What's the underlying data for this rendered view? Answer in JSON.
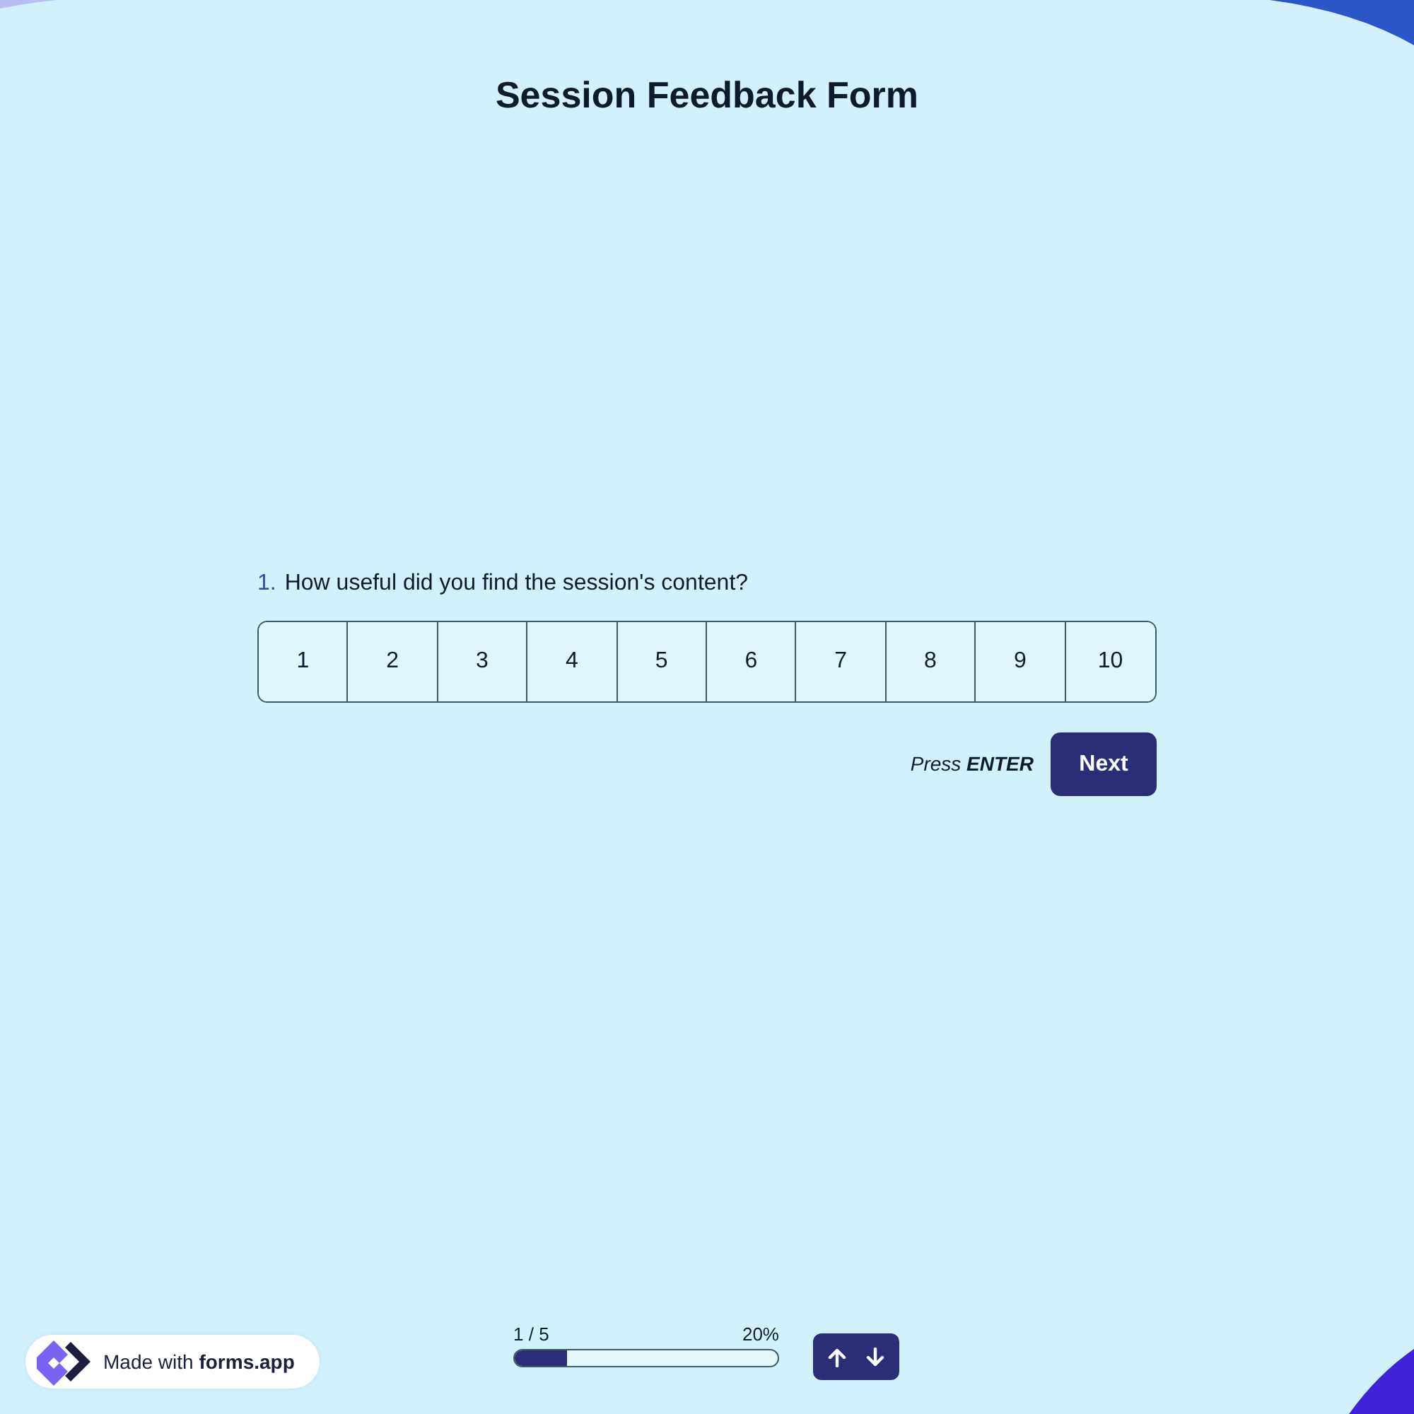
{
  "title": "Session Feedback Form",
  "question": {
    "number": "1.",
    "text": "How useful did you find the session's content?",
    "options": [
      {
        "label": "1",
        "selected": false
      },
      {
        "label": "2",
        "selected": false
      },
      {
        "label": "3",
        "selected": false
      },
      {
        "label": "4",
        "selected": false
      },
      {
        "label": "5",
        "selected": false
      },
      {
        "label": "6",
        "selected": false
      },
      {
        "label": "7",
        "selected": false
      },
      {
        "label": "8",
        "selected": false
      },
      {
        "label": "9",
        "selected": false
      },
      {
        "label": "10",
        "selected": false
      }
    ]
  },
  "actions": {
    "hint": "Press **ENTER**",
    "button": "Next"
  },
  "footer": {
    "badge": "Made with **forms.app**",
    "progress": {
      "label": "1 / 5",
      "percent": "20%",
      "level": 0.2
    }
  }
}
